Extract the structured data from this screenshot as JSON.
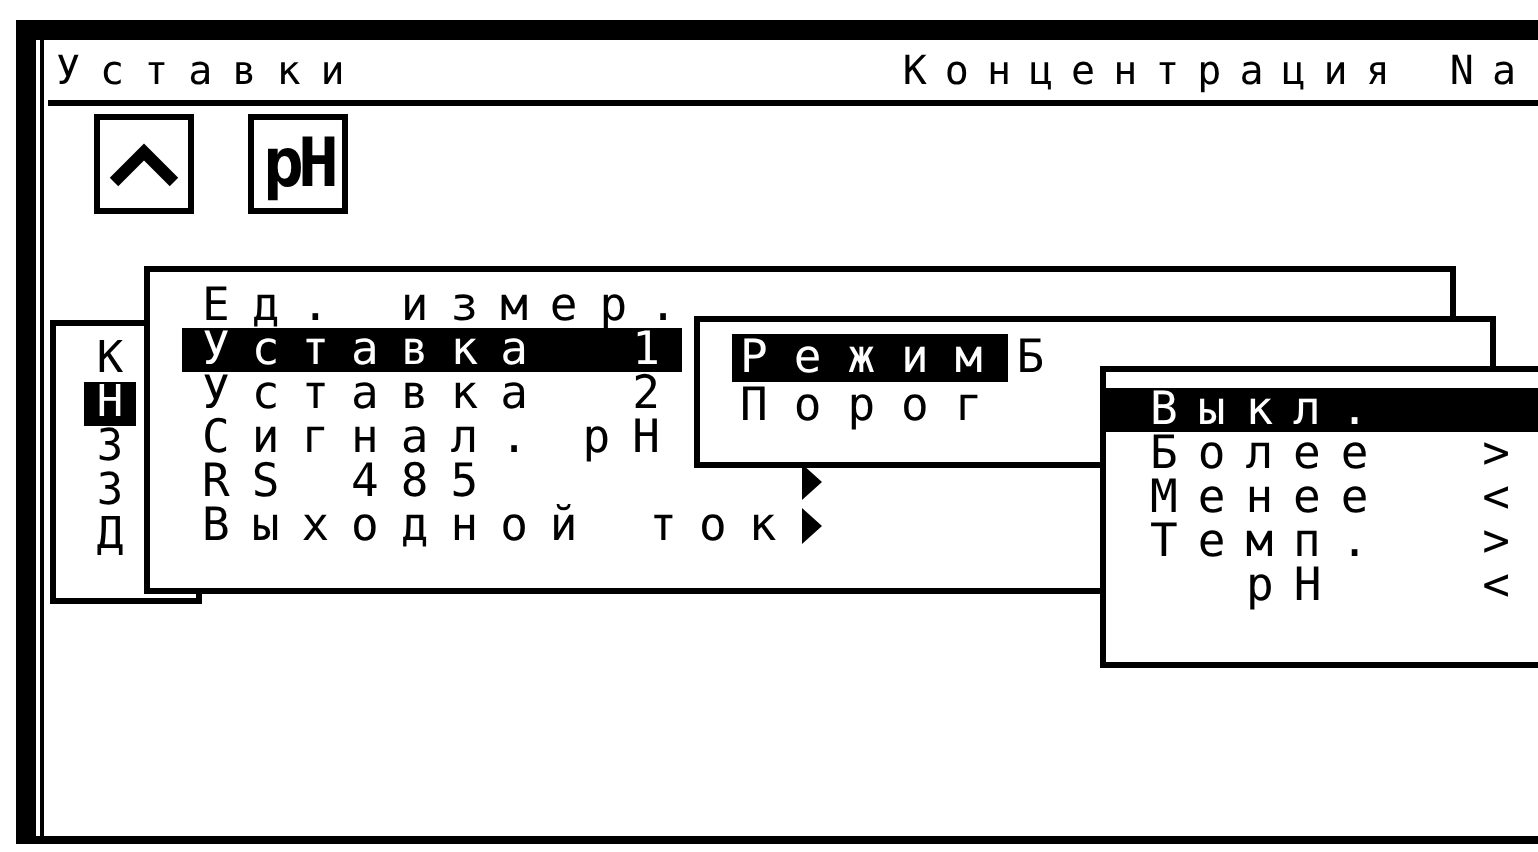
{
  "header": {
    "title": "Уставки",
    "right": "Концентрация Na"
  },
  "toolbar": {
    "ph_label": "pH"
  },
  "background_list": {
    "items": [
      {
        "label": "К",
        "selected": false
      },
      {
        "label": "Н",
        "selected": true
      },
      {
        "label": "З",
        "selected": false
      },
      {
        "label": "З",
        "selected": false
      },
      {
        "label": "Д",
        "selected": false
      }
    ]
  },
  "menu": {
    "items": [
      {
        "label": "Ед. измер.",
        "selected": false,
        "submenu": false
      },
      {
        "label": "Уставка",
        "value": "1",
        "selected": true,
        "submenu": false
      },
      {
        "label": "Уставка",
        "value": "2",
        "selected": false,
        "submenu": false
      },
      {
        "label": "Сигнал.",
        "value": "pH",
        "selected": false,
        "submenu": false
      },
      {
        "label": "RS 485",
        "selected": false,
        "submenu": true
      },
      {
        "label": "Выходной ток",
        "selected": false,
        "submenu": true
      }
    ]
  },
  "submenu": {
    "items": [
      {
        "label": "Режим",
        "value": "Б",
        "selected": true
      },
      {
        "label": "Порог",
        "selected": false
      }
    ]
  },
  "mode_menu": {
    "items": [
      {
        "label": "Выкл.",
        "selected": true,
        "indented": false
      },
      {
        "label": "Более",
        "sign": ">",
        "selected": false,
        "indented": false
      },
      {
        "label": "Менее",
        "sign": "<",
        "selected": false,
        "indented": false
      },
      {
        "label": "Темп.",
        "sign": ">",
        "selected": false,
        "indented": false
      },
      {
        "label": "pH",
        "sign": "<",
        "selected": false,
        "indented": true
      }
    ]
  }
}
